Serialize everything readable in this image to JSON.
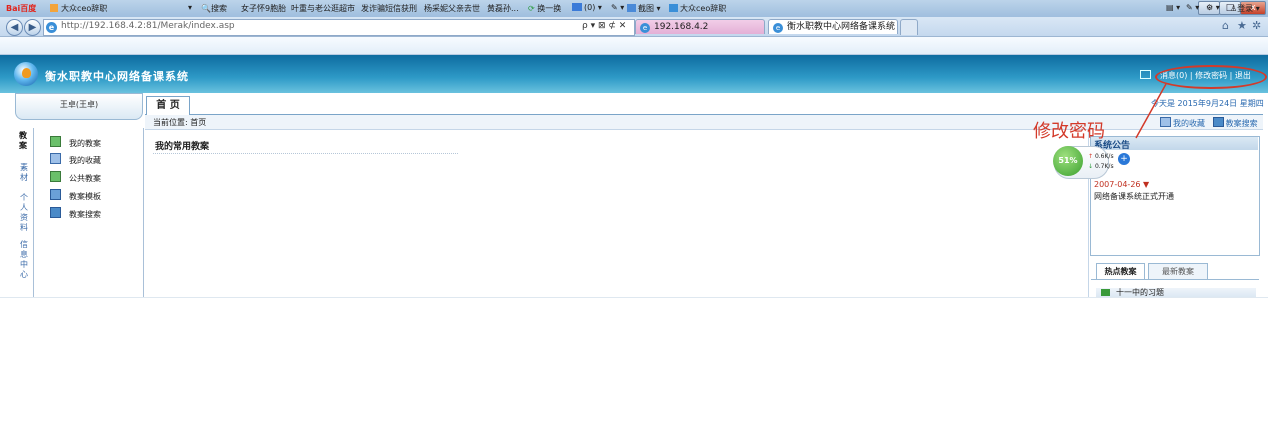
{
  "browser": {
    "url": "http://192.168.4.2:81/Merak/index.asp",
    "address_controls": "ρ ▾ ⊠ ⊄ ✕",
    "tabs": [
      {
        "label": "192.168.4.2"
      },
      {
        "label": "衡水职教中心网络备课系统"
      }
    ],
    "tab_close": "×",
    "window_buttons": {
      "minimize": "–",
      "maximize": "□",
      "close": "x"
    },
    "home_icon": "⌂",
    "star_icon": "★",
    "gear_icon": "✲"
  },
  "toolbar": {
    "baidu_logo": "Bai百度",
    "baidu_item": "大众ceo辞职",
    "search_label": "搜索",
    "news": [
      "女子怀9胞胎",
      "叶重与老公逛超市",
      "发诈骗短信获刑",
      "杨采妮父亲去世",
      "黄磊孙..."
    ],
    "swap": "换一换",
    "mail_count": "(0)",
    "screenshot": "截图",
    "right_item": "大众ceo辞职",
    "login": "登录"
  },
  "app": {
    "title": "衡水职教中心网络备课系统",
    "header_links": "消息(0) | 修改密码 | 退出",
    "user_name": "王卓(王卓)",
    "vertical_tabs": [
      "教案",
      "素材",
      "个人资料",
      "信息中心"
    ],
    "menu": [
      {
        "label": "我的教案",
        "icon": "doc-icon"
      },
      {
        "label": "我的收藏",
        "icon": "favorite-icon"
      },
      {
        "label": "公共教案",
        "icon": "public-icon"
      },
      {
        "label": "教案模板",
        "icon": "template-icon"
      },
      {
        "label": "教案搜索",
        "icon": "search-icon"
      }
    ],
    "main_tab": "首 页",
    "today": "今天是 2015年9月24日 星期四",
    "breadcrumb": "当前位置: 首页",
    "quick_links": [
      "我的收藏",
      "教案搜索"
    ],
    "section_title": "我的常用教案",
    "notice": {
      "title": "系统公告",
      "date": "2007-04-26",
      "marker": "▼",
      "text": "网络备课系统正式开通"
    },
    "hot_tabs": [
      "热点教案",
      "最新教案"
    ],
    "hot_row": "十一中的习题"
  },
  "annotation": {
    "text": "修改密码",
    "color": "#d33a2a"
  },
  "speed_widget": {
    "percent": "51%",
    "up": "0.6K/s",
    "down": "0.7K/s",
    "plus": "+"
  },
  "colors": {
    "header": "#1a7db5",
    "link": "#2a6ab0",
    "annotation": "#d33a2a"
  }
}
